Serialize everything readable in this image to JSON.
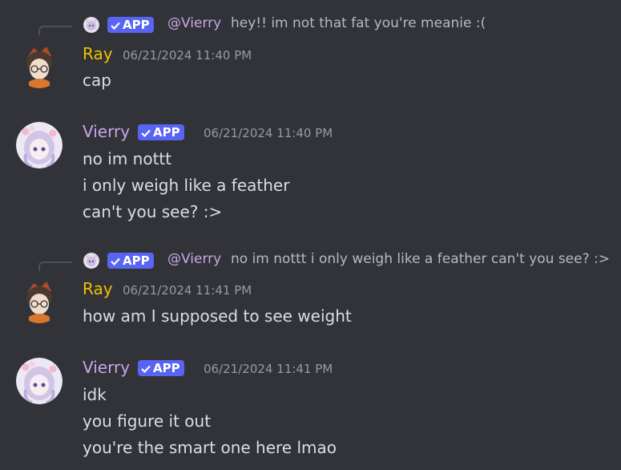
{
  "colors": {
    "background": "#313338",
    "ray_name": "#f0c000",
    "vierry_name": "#c9a7e8",
    "app_badge": "#5865f2",
    "timestamp": "#949ba4"
  },
  "messages": [
    {
      "reply": {
        "badge": "APP",
        "mention": "@Vierry",
        "text": "hey!! im not that fat you're meanie :("
      },
      "author": "Ray",
      "timestamp": "06/21/2024 11:40 PM",
      "lines": [
        "cap"
      ]
    },
    {
      "author": "Vierry",
      "badge": "APP",
      "timestamp": "06/21/2024 11:40 PM",
      "lines": [
        "no im nottt",
        "i only weigh like a feather",
        "can't you see? :>"
      ]
    },
    {
      "reply": {
        "badge": "APP",
        "mention": "@Vierry",
        "text": "no im nottt i only weigh like a feather can't you see? :>"
      },
      "author": "Ray",
      "timestamp": "06/21/2024 11:41 PM",
      "lines": [
        "how am I supposed to see weight"
      ]
    },
    {
      "author": "Vierry",
      "badge": "APP",
      "timestamp": "06/21/2024 11:41 PM",
      "lines": [
        "idk",
        "you figure it out",
        "you're the smart one here lmao"
      ]
    }
  ]
}
